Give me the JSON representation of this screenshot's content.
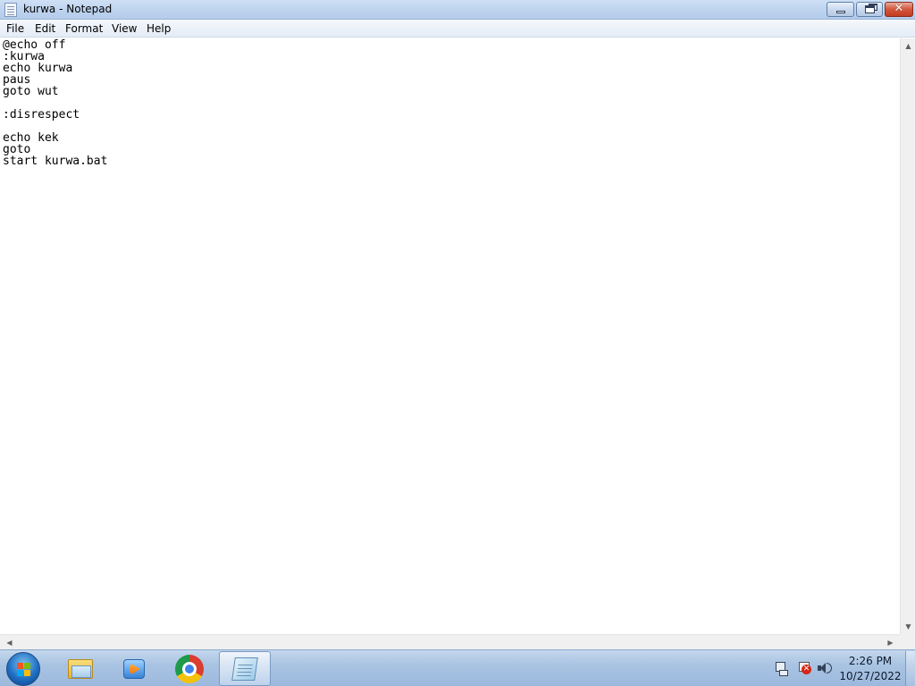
{
  "window": {
    "title": "kurwa - Notepad"
  },
  "menu": {
    "items": [
      {
        "label": "File"
      },
      {
        "label": "Edit"
      },
      {
        "label": "Format"
      },
      {
        "label": "View"
      },
      {
        "label": "Help"
      }
    ]
  },
  "editor": {
    "lines": [
      "@echo off",
      ":kurwa",
      "echo kurwa",
      "paus",
      "goto wut",
      "",
      ":disrespect",
      "",
      "echo kek",
      "goto",
      "start kurwa.bat"
    ]
  },
  "taskbar": {
    "pinned": [
      {
        "icon": "windows-explorer-icon"
      },
      {
        "icon": "windows-media-player-icon"
      },
      {
        "icon": "google-chrome-icon"
      },
      {
        "icon": "notepad-icon",
        "active": true
      }
    ],
    "tray": {
      "icons": [
        "network-icon",
        "action-center-flag-icon",
        "volume-icon"
      ],
      "time": "2:26 PM",
      "date": "10/27/2022"
    }
  },
  "colors": {
    "titlebar": "#bcd2ee",
    "close_button": "#c23c21",
    "taskbar": "#a9c3e2"
  }
}
